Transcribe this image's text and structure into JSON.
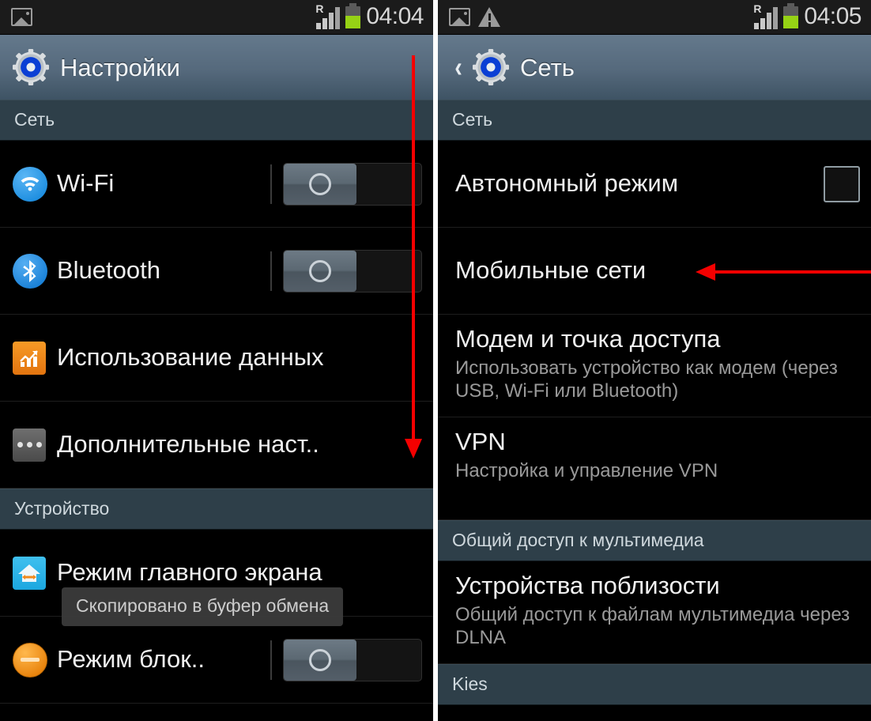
{
  "left_phone": {
    "status_bar": {
      "icons": [
        "image-icon"
      ],
      "roaming_label": "R",
      "time": "04:04"
    },
    "action_bar": {
      "title": "Настройки",
      "icon": "settings-gear-icon"
    },
    "sections": [
      {
        "header": "Сеть",
        "items": [
          {
            "title": "Wi-Fi",
            "icon": "wifi-icon",
            "control": "toggle",
            "toggle_state": "off"
          },
          {
            "title": "Bluetooth",
            "icon": "bluetooth-icon",
            "control": "toggle",
            "toggle_state": "off"
          },
          {
            "title": "Использование данных",
            "icon": "data-usage-icon",
            "control": "none"
          },
          {
            "title": "Дополнительные наст..",
            "icon": "more-settings-icon",
            "control": "none"
          }
        ]
      },
      {
        "header": "Устройство",
        "items": [
          {
            "title": "Режим главного экрана",
            "icon": "home-screen-icon",
            "control": "none"
          },
          {
            "title": "Режим блок..",
            "icon": "blocking-mode-icon",
            "control": "toggle",
            "toggle_state": "off"
          }
        ]
      }
    ],
    "toast": "Скопировано в буфер обмена",
    "annotation": {
      "type": "arrow-down",
      "color": "#f40000"
    }
  },
  "right_phone": {
    "status_bar": {
      "icons": [
        "image-icon",
        "warning-icon"
      ],
      "roaming_label": "R",
      "time": "04:05"
    },
    "action_bar": {
      "title": "Сеть",
      "icon": "settings-gear-icon",
      "back": "back-chevron-icon"
    },
    "sections": [
      {
        "header": "Сеть",
        "items": [
          {
            "title": "Автономный режим",
            "subtitle": "",
            "control": "checkbox",
            "checkbox_state": "unchecked"
          },
          {
            "title": "Мобильные сети",
            "subtitle": "",
            "control": "none"
          },
          {
            "title": "Модем и точка доступа",
            "subtitle": "Использовать устройство как модем (через USB, Wi-Fi или Bluetooth)",
            "control": "none"
          },
          {
            "title": "VPN",
            "subtitle": "Настройка и управление VPN",
            "control": "none"
          }
        ]
      },
      {
        "header": "Общий доступ к мультимедиа",
        "items": [
          {
            "title": "Устройства поблизости",
            "subtitle": "Общий доступ к файлам мультимедиа через DLNA",
            "control": "none"
          }
        ]
      },
      {
        "header": "Kies",
        "items": []
      }
    ],
    "annotation": {
      "type": "arrow-left",
      "color": "#f40000",
      "points_to": "Мобильные сети"
    }
  },
  "colors": {
    "accent_red": "#f40000",
    "section_header_bg": "#2e3f49",
    "actionbar_top": "#64798c",
    "battery_green": "#96d215"
  }
}
